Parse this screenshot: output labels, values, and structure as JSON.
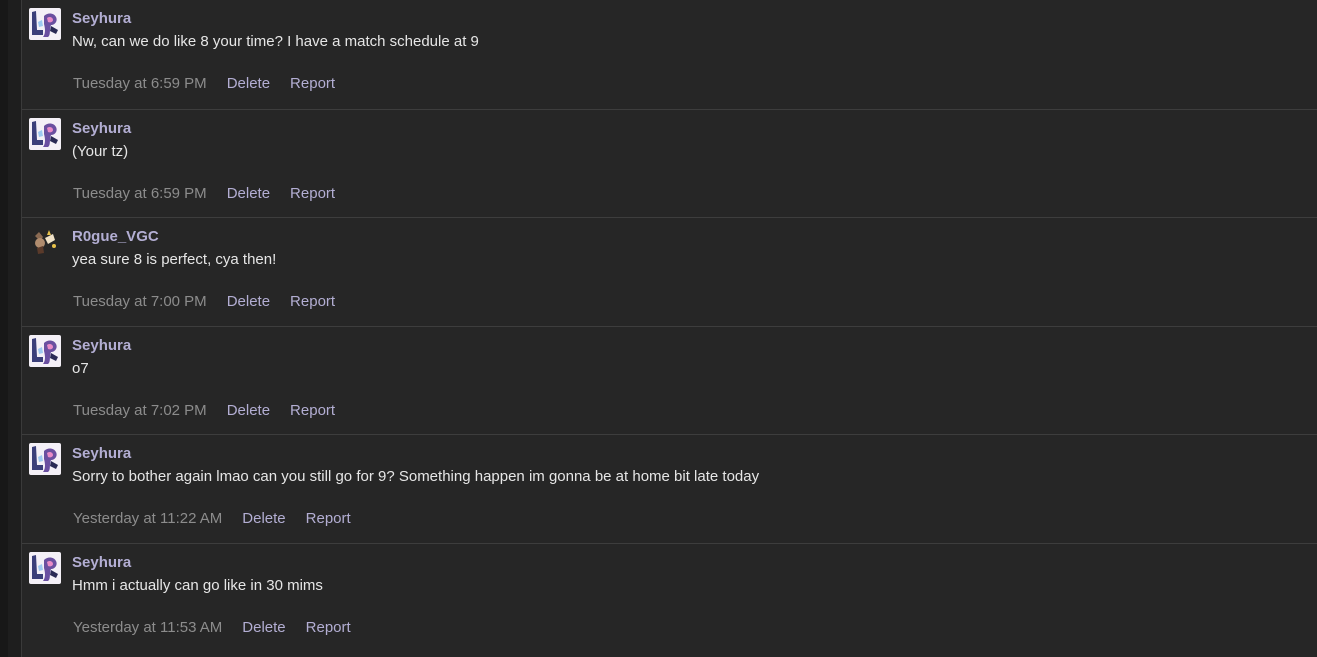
{
  "messages": [
    {
      "author": "Seyhura",
      "avatar": "seyhura-avatar",
      "text": "Nw, can we do like 8 your time? I have a match schedule at 9",
      "time": "Tuesday at 6:59 PM",
      "delete_label": "Delete",
      "report_label": "Report"
    },
    {
      "author": "Seyhura",
      "avatar": "seyhura-avatar",
      "text": "(Your tz)",
      "time": "Tuesday at 6:59 PM",
      "delete_label": "Delete",
      "report_label": "Report"
    },
    {
      "author": "R0gue_VGC",
      "avatar": "r0gue-avatar",
      "text": "yea sure 8 is perfect, cya then!",
      "time": "Tuesday at 7:00 PM",
      "delete_label": "Delete",
      "report_label": "Report"
    },
    {
      "author": "Seyhura",
      "avatar": "seyhura-avatar",
      "text": "o7",
      "time": "Tuesday at 7:02 PM",
      "delete_label": "Delete",
      "report_label": "Report"
    },
    {
      "author": "Seyhura",
      "avatar": "seyhura-avatar",
      "text": "Sorry to bother again lmao can you still go for 9? Something happen im gonna be at home bit late today",
      "time": "Yesterday at 11:22 AM",
      "delete_label": "Delete",
      "report_label": "Report"
    },
    {
      "author": "Seyhura",
      "avatar": "seyhura-avatar",
      "text": "Hmm i actually can go like in 30 mims",
      "time": "Yesterday at 11:53 AM",
      "delete_label": "Delete",
      "report_label": "Report"
    }
  ],
  "colors": {
    "background": "#262626",
    "author": "#b3aed3",
    "text": "#e6e6e6",
    "time": "#8c8c8c",
    "action": "#b3aed3"
  }
}
